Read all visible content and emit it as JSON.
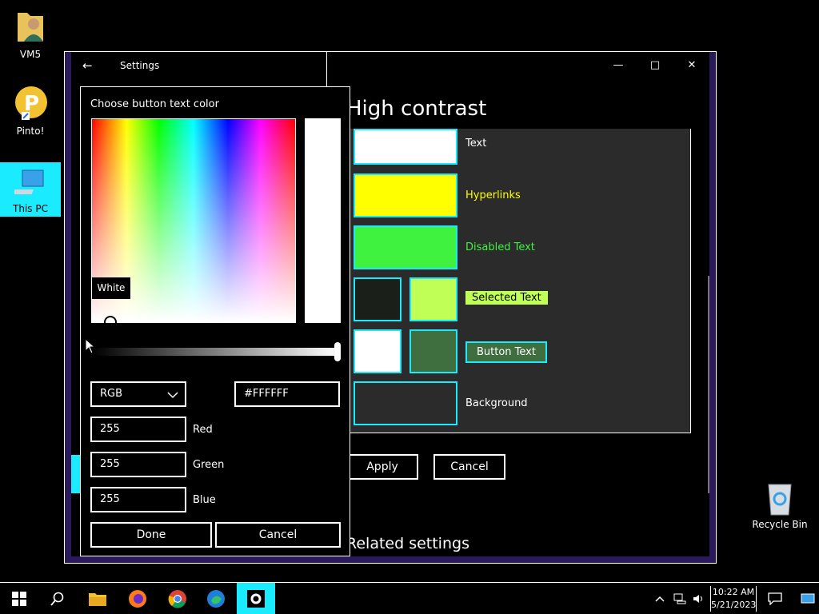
{
  "desktop": {
    "icons": [
      {
        "label": "VM5"
      },
      {
        "label": "Pinto!"
      },
      {
        "label": "This PC"
      }
    ],
    "recycle_bin": "Recycle Bin"
  },
  "window": {
    "title": "Settings",
    "page_title": "High contrast",
    "theme_items": [
      {
        "label": "Text",
        "swatch_color": "#ffffff",
        "label_color": "#ffffff"
      },
      {
        "label": "Hyperlinks",
        "swatch_color": "#ffff00",
        "label_color": "#ffff00"
      },
      {
        "label": "Disabled Text",
        "swatch_color": "#3ff23f",
        "label_color": "#3ff23f"
      },
      {
        "label": "Selected Text",
        "swatch_bg": "#1a1f1a",
        "swatch_fg": "#c0ff55"
      },
      {
        "label": "Button Text",
        "swatch_bg": "#ffffff",
        "swatch_fg": "#3f6e3f"
      },
      {
        "label": "Background",
        "swatch_color": "#2b2b2b"
      }
    ],
    "apply_label": "Apply",
    "cancel_label": "Cancel",
    "related_settings": "Related settings"
  },
  "dialog": {
    "title": "Choose button text color",
    "tooltip": "White",
    "mode": "RGB",
    "hex": "#FFFFFF",
    "red": "255",
    "green": "255",
    "blue": "255",
    "red_label": "Red",
    "green_label": "Green",
    "blue_label": "Blue",
    "done_label": "Done",
    "cancel_label": "Cancel",
    "brightness": 1.0
  },
  "taskbar": {
    "time": "10:22 AM",
    "date": "5/21/2023"
  },
  "colors": {
    "accent": "#1aebff",
    "window_border": "#2a1a5c"
  }
}
